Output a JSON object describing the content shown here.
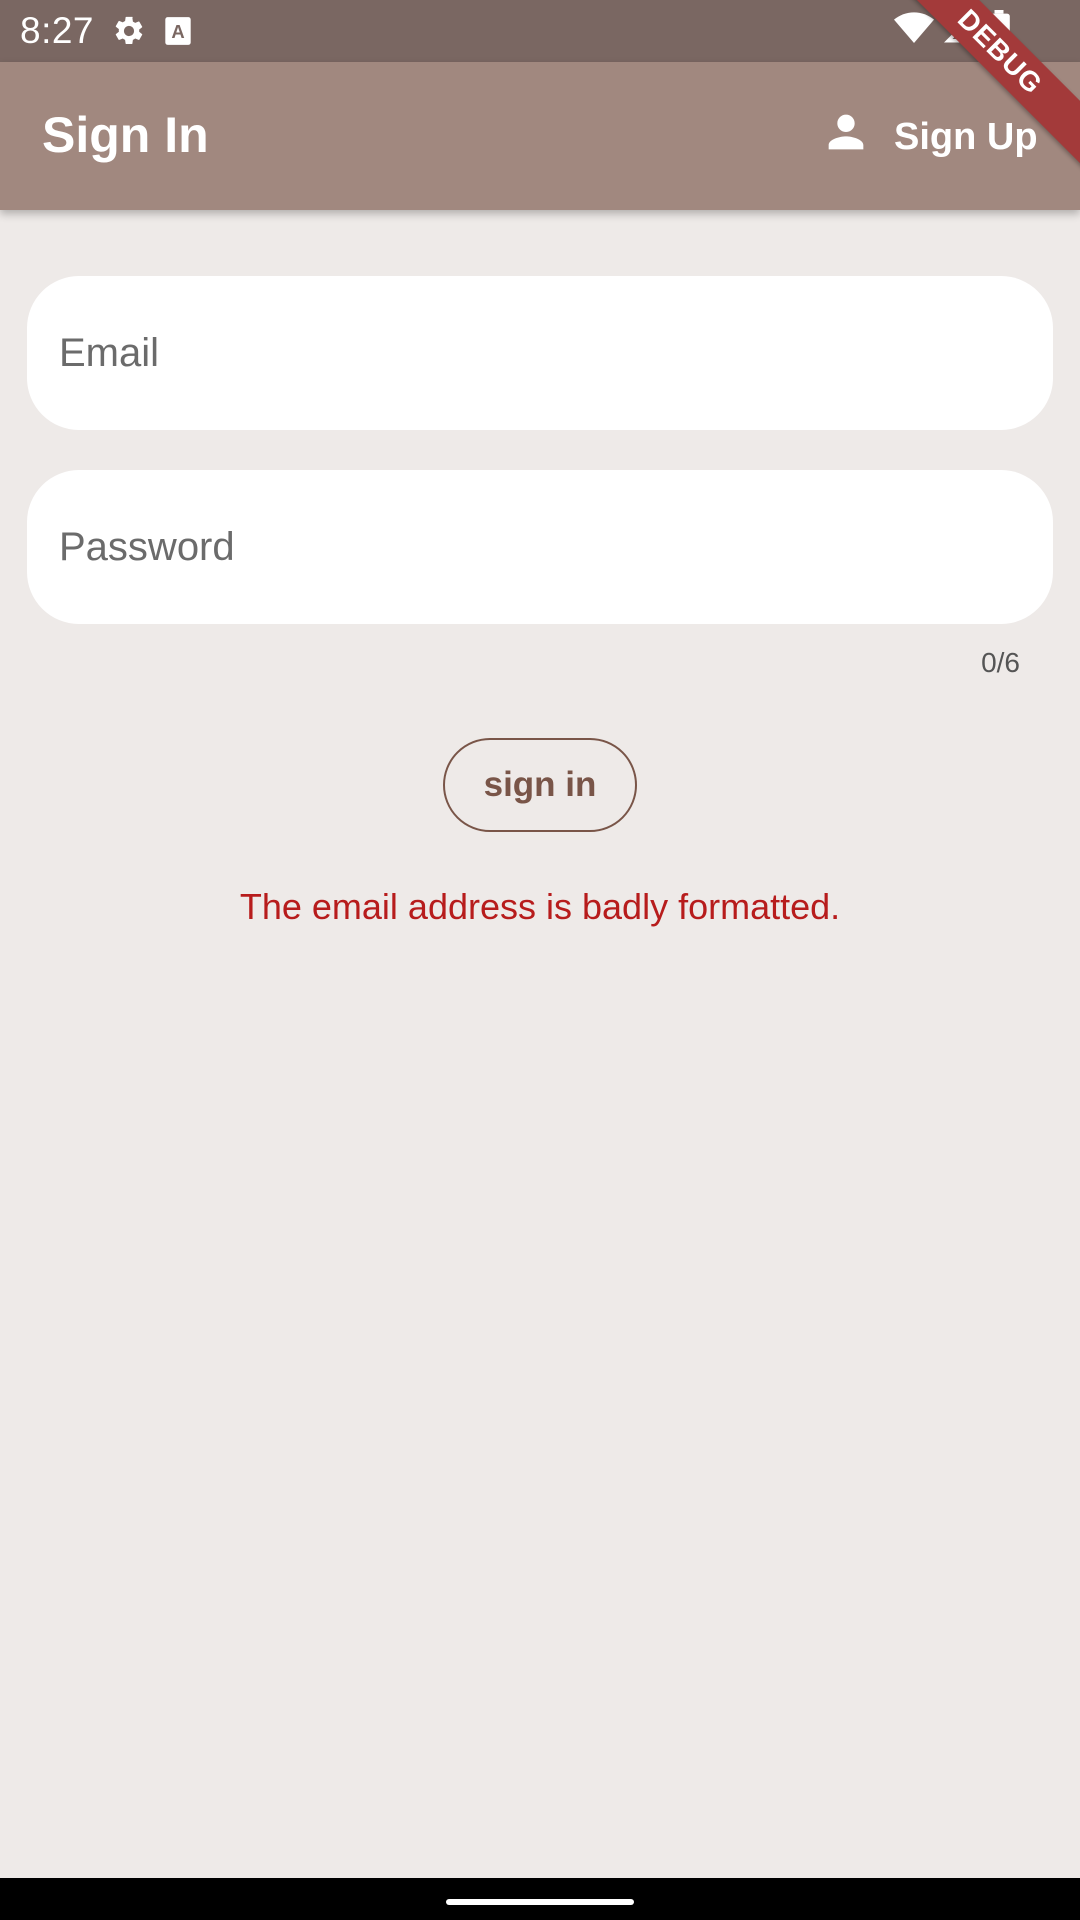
{
  "status_bar": {
    "time": "8:27",
    "icons": [
      "gear-icon",
      "a-square-icon",
      "wifi-icon",
      "signal-icon",
      "battery-icon"
    ]
  },
  "debug_banner": {
    "label": "DEBUG"
  },
  "app_bar": {
    "title": "Sign In",
    "action_label": "Sign Up",
    "action_icon": "person-icon",
    "background": "#A1887F"
  },
  "form": {
    "email": {
      "placeholder": "Email",
      "value": ""
    },
    "password": {
      "placeholder": "Password",
      "value": "",
      "counter": "0/6"
    },
    "submit_label": "sign in",
    "error_message": "The email address is badly formatted."
  },
  "colors": {
    "accent": "#795548",
    "error": "#B71C1C",
    "status_bar": "#7A6762",
    "background": "#EEEAE8"
  }
}
